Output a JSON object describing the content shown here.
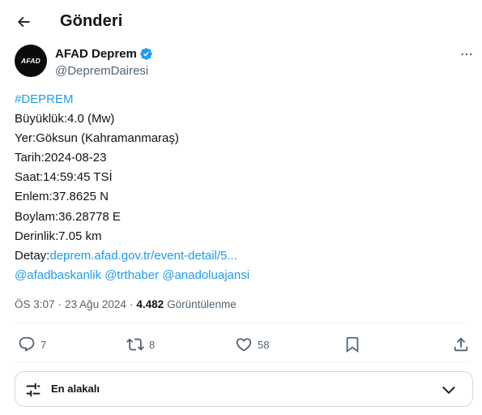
{
  "header": {
    "title": "Gönderi"
  },
  "author": {
    "avatar_text": "AFAD",
    "display_name": "AFAD Deprem",
    "handle": "@DepremDairesi"
  },
  "tweet": {
    "hashtag": "#DEPREM",
    "lines": [
      "Büyüklük:4.0 (Mw)",
      "Yer:Göksun (Kahramanmaraş)",
      "Tarih:2024-08-23",
      "Saat:14:59:45 TSİ",
      "Enlem:37.8625 N",
      "Boylam:36.28778 E",
      "Derinlik:7.05 km"
    ],
    "detail_label": "Detay:",
    "detail_link": "deprem.afad.gov.tr/event-detail/5...",
    "mentions": [
      "@afadbaskanlik",
      "@trthaber",
      "@anadoluajansi"
    ]
  },
  "meta": {
    "time": "ÖS 3:07",
    "separator": "·",
    "date": "23 Ağu 2024",
    "views_count": "4.482",
    "views_label": "Görüntülenme"
  },
  "actions": {
    "replies": "7",
    "retweets": "8",
    "likes": "58"
  },
  "sort": {
    "label": "En alakalı"
  },
  "colors": {
    "link": "#1d9bf0",
    "text": "#0f1419",
    "secondary": "#536471",
    "border": "#cfd9de"
  }
}
